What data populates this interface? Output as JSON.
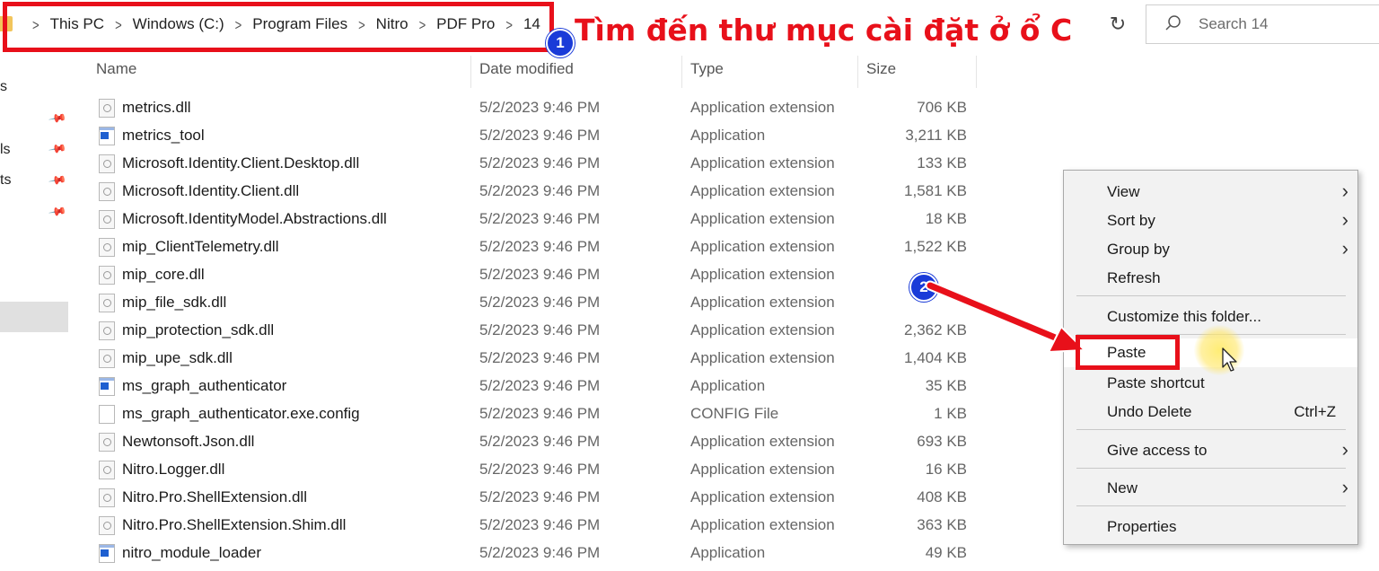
{
  "address": {
    "crumbs": [
      "This PC",
      "Windows (C:)",
      "Program Files",
      "Nitro",
      "PDF Pro",
      "14"
    ],
    "separator": ">"
  },
  "search": {
    "placeholder": "Search 14"
  },
  "annotation": {
    "step1": "1",
    "caption": "Tìm đến thư mục cài đặt ở ổ C",
    "step2": "2",
    "color": "#e8101a",
    "badge_color": "#1a3bd8"
  },
  "nav": {
    "partial_labels": [
      "s",
      "ls",
      "ts"
    ]
  },
  "columns": {
    "name": "Name",
    "date": "Date modified",
    "type": "Type",
    "size": "Size"
  },
  "files": [
    {
      "name": "metrics.dll",
      "date": "5/2/2023 9:46 PM",
      "type": "Application extension",
      "size": "706 KB",
      "icon": "dll"
    },
    {
      "name": "metrics_tool",
      "date": "5/2/2023 9:46 PM",
      "type": "Application",
      "size": "3,211 KB",
      "icon": "app"
    },
    {
      "name": "Microsoft.Identity.Client.Desktop.dll",
      "date": "5/2/2023 9:46 PM",
      "type": "Application extension",
      "size": "133 KB",
      "icon": "dll"
    },
    {
      "name": "Microsoft.Identity.Client.dll",
      "date": "5/2/2023 9:46 PM",
      "type": "Application extension",
      "size": "1,581 KB",
      "icon": "dll"
    },
    {
      "name": "Microsoft.IdentityModel.Abstractions.dll",
      "date": "5/2/2023 9:46 PM",
      "type": "Application extension",
      "size": "18 KB",
      "icon": "dll"
    },
    {
      "name": "mip_ClientTelemetry.dll",
      "date": "5/2/2023 9:46 PM",
      "type": "Application extension",
      "size": "1,522 KB",
      "icon": "dll"
    },
    {
      "name": "mip_core.dll",
      "date": "5/2/2023 9:46 PM",
      "type": "Application extension",
      "size": "",
      "icon": "dll"
    },
    {
      "name": "mip_file_sdk.dll",
      "date": "5/2/2023 9:46 PM",
      "type": "Application extension",
      "size": "",
      "icon": "dll"
    },
    {
      "name": "mip_protection_sdk.dll",
      "date": "5/2/2023 9:46 PM",
      "type": "Application extension",
      "size": "2,362 KB",
      "icon": "dll"
    },
    {
      "name": "mip_upe_sdk.dll",
      "date": "5/2/2023 9:46 PM",
      "type": "Application extension",
      "size": "1,404 KB",
      "icon": "dll"
    },
    {
      "name": "ms_graph_authenticator",
      "date": "5/2/2023 9:46 PM",
      "type": "Application",
      "size": "35 KB",
      "icon": "app"
    },
    {
      "name": "ms_graph_authenticator.exe.config",
      "date": "5/2/2023 9:46 PM",
      "type": "CONFIG File",
      "size": "1 KB",
      "icon": "file"
    },
    {
      "name": "Newtonsoft.Json.dll",
      "date": "5/2/2023 9:46 PM",
      "type": "Application extension",
      "size": "693 KB",
      "icon": "dll"
    },
    {
      "name": "Nitro.Logger.dll",
      "date": "5/2/2023 9:46 PM",
      "type": "Application extension",
      "size": "16 KB",
      "icon": "dll"
    },
    {
      "name": "Nitro.Pro.ShellExtension.dll",
      "date": "5/2/2023 9:46 PM",
      "type": "Application extension",
      "size": "408 KB",
      "icon": "dll"
    },
    {
      "name": "Nitro.Pro.ShellExtension.Shim.dll",
      "date": "5/2/2023 9:46 PM",
      "type": "Application extension",
      "size": "363 KB",
      "icon": "dll"
    },
    {
      "name": "nitro_module_loader",
      "date": "5/2/2023 9:46 PM",
      "type": "Application",
      "size": "49 KB",
      "icon": "app"
    }
  ],
  "context_menu": {
    "items": [
      {
        "label": "View",
        "submenu": true
      },
      {
        "label": "Sort by",
        "submenu": true
      },
      {
        "label": "Group by",
        "submenu": true
      },
      {
        "label": "Refresh"
      },
      {
        "label": "Customize this folder..."
      },
      {
        "label": "Paste",
        "highlighted": true
      },
      {
        "label": "Paste shortcut"
      },
      {
        "label": "Undo Delete",
        "shortcut": "Ctrl+Z"
      },
      {
        "label": "Give access to",
        "submenu": true
      },
      {
        "label": "New",
        "submenu": true
      },
      {
        "label": "Properties"
      }
    ],
    "submenu_glyph": "›"
  }
}
